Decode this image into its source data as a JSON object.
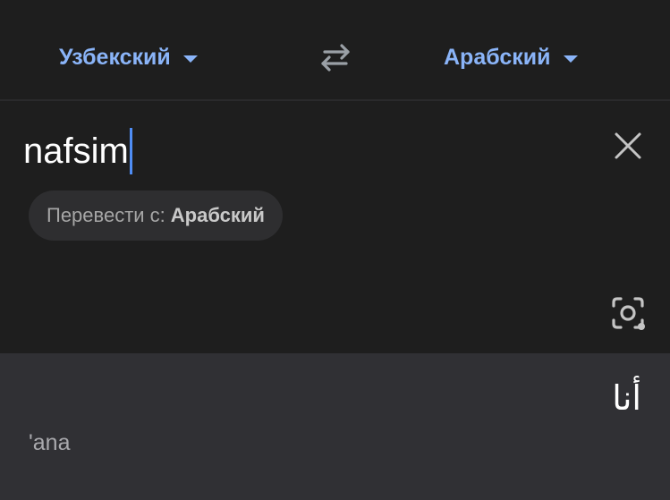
{
  "lang_bar": {
    "source_lang": "Узбекский",
    "target_lang": "Арабский",
    "icons": {
      "dropdown": "caret-down-icon",
      "swap": "swap-arrows-icon"
    }
  },
  "input": {
    "text": "nafsim",
    "clear_icon": "close-icon",
    "camera_icon": "camera-lens-icon"
  },
  "detect_chip": {
    "prefix": "Перевести с:",
    "language": "Арабский"
  },
  "result": {
    "translation": "أنا",
    "transliteration": "'ana"
  },
  "colors": {
    "background": "#1e1e1e",
    "result_panel": "#303034",
    "accent": "#8ab4f8",
    "cursor": "#4f8df5"
  }
}
